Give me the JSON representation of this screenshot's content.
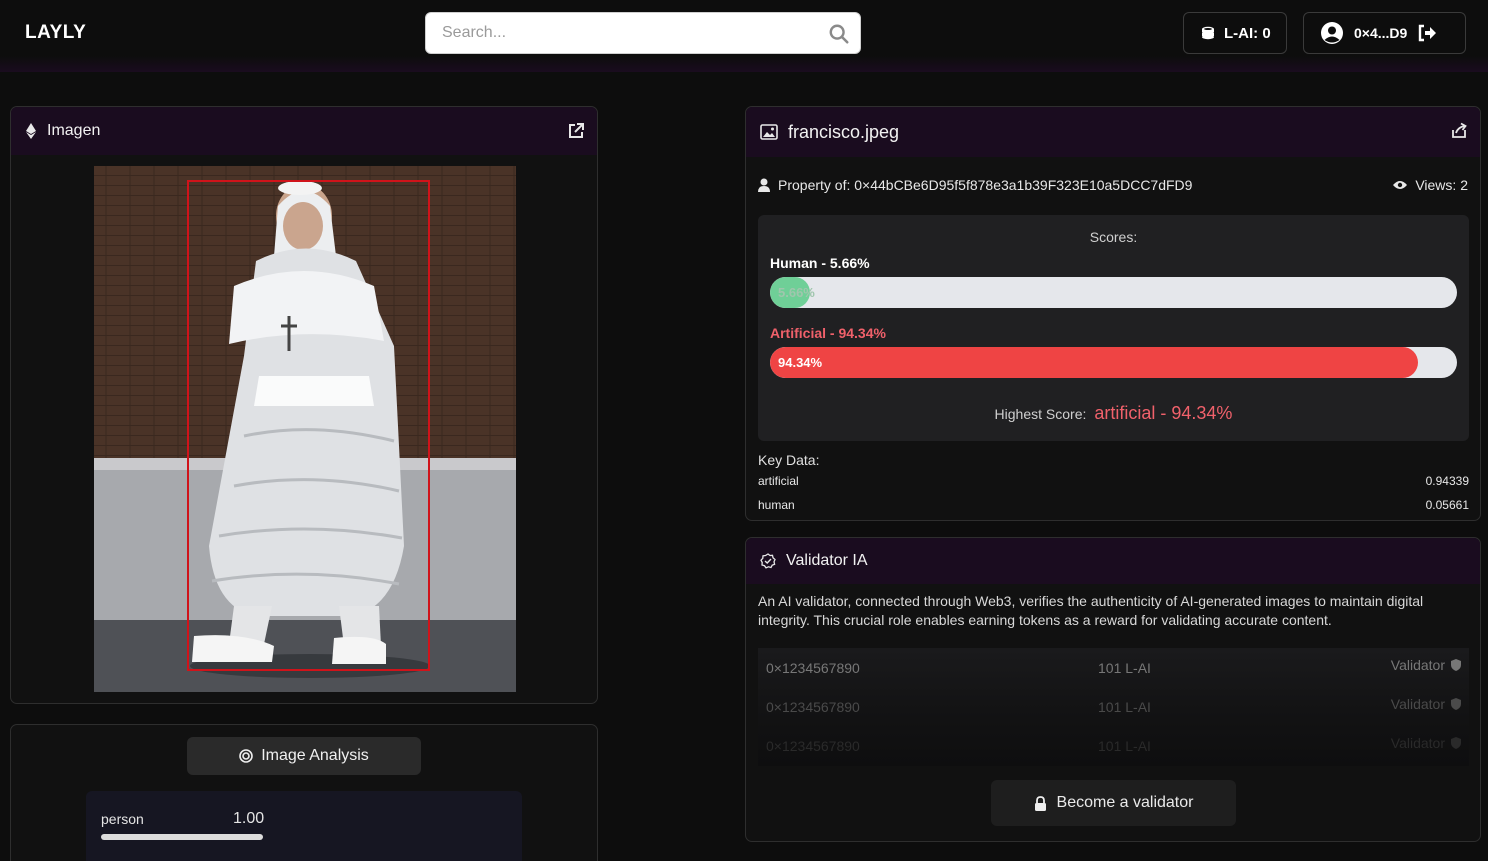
{
  "header": {
    "logo": "LAYLY",
    "search_placeholder": "Search...",
    "token_label": "L-AI: 0",
    "account_label": "0×4...D9"
  },
  "image_panel": {
    "title": "Imagen"
  },
  "analysis_panel": {
    "button_label": "Image Analysis",
    "detections": [
      {
        "label": "person",
        "score": "1.00",
        "score_fraction": 1.0
      }
    ]
  },
  "file_panel": {
    "filename": "francisco.jpeg",
    "property": "Property of: 0×44bCBe6D95f5f878e3a1b39F323E10a5DCC7dFD9",
    "views": "Views: 2",
    "scores_title": "Scores:",
    "human": {
      "label": "Human - 5.66%",
      "bar_text": "5.66%",
      "percent": 5.66,
      "color": "#6fcf97"
    },
    "artificial": {
      "label": "Artificial - 94.34%",
      "bar_text": "94.34%",
      "percent": 94.34,
      "color": "#ef4444"
    },
    "highest_label": "Highest Score:",
    "highest_value": "artificial - 94.34%",
    "key_data_title": "Key Data:",
    "key_data": [
      {
        "name": "artificial",
        "value": "0.94339"
      },
      {
        "name": "human",
        "value": "0.05661"
      }
    ]
  },
  "validator_panel": {
    "title": "Validator IA",
    "description": "An AI validator, connected through Web3, verifies the authenticity of AI-generated images to maintain digital integrity. This crucial role enables earning tokens as a reward for validating accurate content.",
    "rows": [
      {
        "address": "0×1234567890",
        "amount": "101 L-AI",
        "role": "Validator"
      },
      {
        "address": "0×1234567890",
        "amount": "101 L-AI",
        "role": "Validator"
      },
      {
        "address": "0×1234567890",
        "amount": "101 L-AI",
        "role": "Validator"
      }
    ],
    "button_label": "Become a validator"
  },
  "colors": {
    "accent_header": "#1a0c1f",
    "artificial": "#ef4444",
    "human": "#6fcf97",
    "highest": "#f0616b"
  }
}
